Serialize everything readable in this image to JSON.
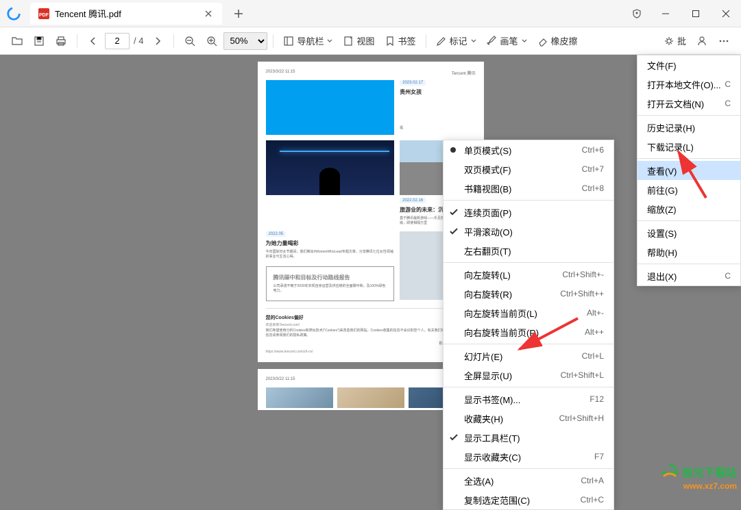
{
  "titlebar": {
    "tab_title": "Tencent 腾讯.pdf"
  },
  "toolbar": {
    "page_current": "2",
    "page_total": "/ 4",
    "zoom": "50%",
    "nav_label": "导航栏",
    "view_label": "视图",
    "bookmark_label": "书签",
    "mark_label": "标记",
    "pen_label": "画笔",
    "eraser_label": "橡皮擦",
    "approve_label": "批"
  },
  "page_content": {
    "timestamp": "2023/3/22 11:15",
    "brand": "Tencent 腾讯",
    "date1": "2023.02.17",
    "title1": "贵州女孩",
    "snippet1": "提",
    "date2": "2022.02.16",
    "title2": "旅游业的未来：沉浸式文旅",
    "text2": "基于腾讯最新游戏——乐见技术，更博物馆统升级，即使相隔万里",
    "date3": "2022.05",
    "title3": "为她力量喝彩",
    "text3": "今年国际妇女节期间，我们推出#WomenWhoLead专题文章，分享腾讯七位女性领袖的事业与生活心得。",
    "report_title": "腾讯碳中和目标及行动路线报告",
    "report_text": "公司承诺不晚于2030年实现自身运营及供应链的全面碳中和，及100%绿色电力。",
    "cookie_title": "您的Cookies偏好",
    "cookie_sub": "欢迎来到Tencent.com!",
    "cookie_text": "我们希望使用分析Cookies和类似技术(\"Cookies\")来改善我们的网站。Cookies收集的信息不会识别您个人。有关我们使用的Cookies的更多信息请参阅我们的隐私政策。",
    "cookie_btn": "拒绝所有分析型Cookies",
    "footer_url": "https://www.tencent.com/zh-cn/"
  },
  "main_menu": {
    "file": "文件(F)",
    "open_local": "打开本地文件(O)...",
    "open_local_shortcut": "C",
    "open_cloud": "打开云文档(N)",
    "open_cloud_shortcut": "C",
    "history": "历史记录(H)",
    "downloads": "下载记录(L)",
    "view": "查看(V)",
    "goto": "前往(G)",
    "zoom": "缩放(Z)",
    "settings": "设置(S)",
    "help": "帮助(H)",
    "exit": "退出(X)",
    "exit_shortcut": "C"
  },
  "view_menu": {
    "single_page": "单页模式(S)",
    "single_page_sc": "Ctrl+6",
    "double_page": "双页模式(F)",
    "double_page_sc": "Ctrl+7",
    "book_view": "书籍视图(B)",
    "book_view_sc": "Ctrl+8",
    "continuous": "连续页面(P)",
    "smooth_scroll": "平滑滚动(O)",
    "flip_lr": "左右翻页(T)",
    "rotate_left": "向左旋转(L)",
    "rotate_left_sc": "Ctrl+Shift+-",
    "rotate_right": "向右旋转(R)",
    "rotate_right_sc": "Ctrl+Shift++",
    "rotate_cur_left": "向左旋转当前页(L)",
    "rotate_cur_left_sc": "Alt+-",
    "rotate_cur_right": "向右旋转当前页(R)",
    "rotate_cur_right_sc": "Alt++",
    "slideshow": "幻灯片(E)",
    "slideshow_sc": "Ctrl+L",
    "fullscreen": "全屏显示(U)",
    "fullscreen_sc": "Ctrl+Shift+L",
    "show_bookmark": "显示书签(M)...",
    "show_bookmark_sc": "F12",
    "favorites": "收藏夹(H)",
    "favorites_sc": "Ctrl+Shift+H",
    "show_toolbar": "显示工具栏(T)",
    "show_favorites": "显示收藏夹(C)",
    "show_favorites_sc": "F7",
    "select_all": "全选(A)",
    "select_all_sc": "Ctrl+A",
    "copy_selection": "复制选定范围(C)",
    "copy_selection_sc": "Ctrl+C"
  },
  "watermark": {
    "brand": "极光下载站",
    "url": "www.xz7.com"
  }
}
